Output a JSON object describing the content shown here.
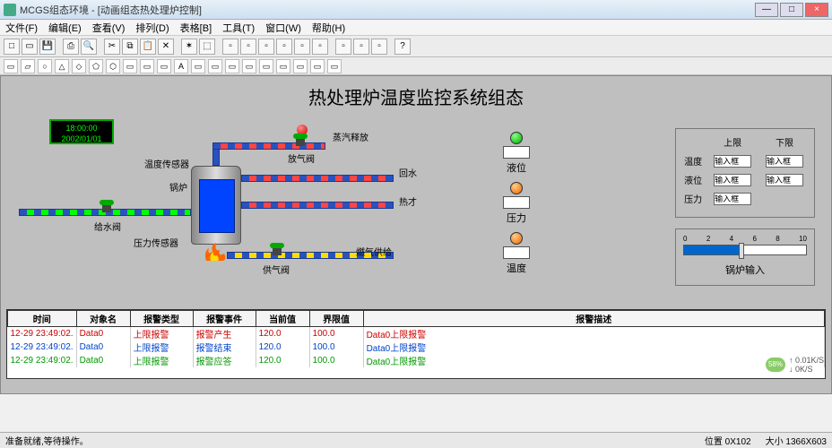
{
  "window": {
    "title": "MCGS组态环境 - [动画组态热处理炉控制]"
  },
  "menu": [
    "文件(F)",
    "编辑(E)",
    "查看(V)",
    "排列(D)",
    "表格[B]",
    "工具(T)",
    "窗口(W)",
    "帮助(H)"
  ],
  "main_title": "热处理炉温度监控系统组态",
  "clock": {
    "time": "18:00:00",
    "date": "2002/01/01"
  },
  "labels": {
    "steam_release": "蒸汽释放",
    "exhaust_valve": "放气阀",
    "return_water": "回水",
    "heating": "热才",
    "fuel_supply": "燃气供给",
    "supply_valve": "供气阀",
    "water_valve": "给水阀",
    "temp_sensor": "温度传感器",
    "boiler": "锅炉",
    "pressure_sensor": "压力传感器"
  },
  "indicators": {
    "level": "液位",
    "pressure": "压力",
    "temperature": "温度"
  },
  "limits": {
    "upper": "上限",
    "lower": "下限",
    "temp": "温度",
    "level": "液位",
    "press": "压力",
    "placeholder": "输入框"
  },
  "slider": {
    "ticks": [
      "0",
      "2",
      "4",
      "6",
      "8",
      "10"
    ],
    "label": "锅炉输入"
  },
  "alarm_headers": [
    "时间",
    "对象名",
    "报警类型",
    "报警事件",
    "当前值",
    "界限值",
    "报警描述"
  ],
  "alarms": [
    {
      "t": "12-29 23:49:02",
      "o": "Data0",
      "ty": "上限报警",
      "e": "报警产生",
      "cv": "120.0",
      "lv": "100.0",
      "d": "Data0上限报警"
    },
    {
      "t": "12-29 23:49:02",
      "o": "Data0",
      "ty": "上限报警",
      "e": "报警结束",
      "cv": "120.0",
      "lv": "100.0",
      "d": "Data0上限报警"
    },
    {
      "t": "12-29 23:49:02",
      "o": "Data0",
      "ty": "上限报警",
      "e": "报警应答",
      "cv": "120.0",
      "lv": "100.0",
      "d": "Data0上限报警"
    }
  ],
  "status": {
    "ready": "准备就绪,等待操作。",
    "pos": "位置 0X102",
    "size": "大小 1366X603"
  },
  "net": {
    "pct": "58%",
    "up": "↑ 0.01K/S",
    "down": "↓ 0K/S"
  }
}
